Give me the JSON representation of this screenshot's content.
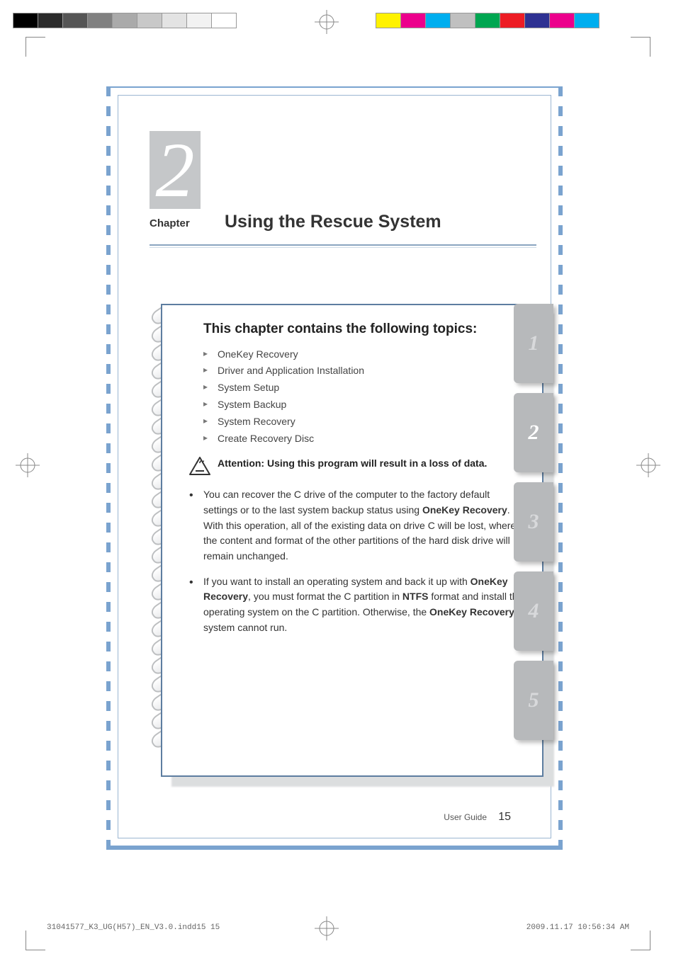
{
  "printer_bars_left": [
    "#000000",
    "#2b2b2b",
    "#555555",
    "#808080",
    "#aaaaaa",
    "#c8c8c8",
    "#e3e3e3",
    "#f2f2f2",
    "#ffffff"
  ],
  "printer_bars_right": [
    "#fff200",
    "#ec008c",
    "#00aeef",
    "#c0c0c0",
    "#00a651",
    "#ed1c24",
    "#2e3192",
    "#ec008c",
    "#00aeef"
  ],
  "chapter": {
    "number": "2",
    "label": "Chapter",
    "title": "Using the Rescue System"
  },
  "topics": {
    "heading": "This chapter contains the following topics:",
    "items": [
      "OneKey Recovery",
      "Driver and Application Installation",
      "System Setup",
      "System Backup",
      "System Recovery",
      "Create Recovery Disc"
    ],
    "attention": "Attention: Using this program will result in a loss of data.",
    "bullets": [
      {
        "pre": "You can recover the C drive of the computer to the factory default settings or to the last system backup status using ",
        "b1": "OneKey Recovery",
        "mid": ". With this operation, all of the existing data on drive C will be lost, whereas the content and format of the other partitions of the hard disk drive will remain unchanged.",
        "b2": "",
        "mid2": "",
        "b3": "",
        "post": ""
      },
      {
        "pre": "If you want to install an operating system and back it up with ",
        "b1": "OneKey Recovery",
        "mid": ", you must format the C partition in ",
        "b2": "NTFS",
        "mid2": " format and install the operating system on the C partition. Otherwise, the ",
        "b3": "OneKey Recovery",
        "post": " system cannot run."
      }
    ]
  },
  "tabs": [
    "1",
    "2",
    "3",
    "4",
    "5"
  ],
  "active_tab_index": 1,
  "footer": {
    "label": "User Guide",
    "page": "15"
  },
  "slug": {
    "file": "31041577_K3_UG(H57)_EN_V3.0.indd15   15",
    "timestamp": "2009.11.17   10:56:34 AM"
  }
}
